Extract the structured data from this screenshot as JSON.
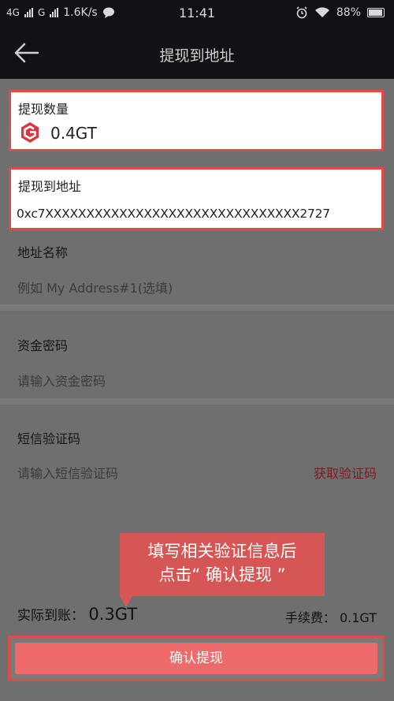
{
  "status_bar": {
    "network_1": "4G",
    "network_2": "G",
    "speed": "1.6K/s",
    "time": "11:41",
    "battery": "88%",
    "icons": [
      "signal-icon",
      "message-icon",
      "alarm-icon",
      "wifi-icon",
      "battery-icon"
    ]
  },
  "header": {
    "title": "提现到地址",
    "back_icon": "back-arrow-icon"
  },
  "amount": {
    "label": "提现数量",
    "coin_icon": "gt-coin-icon",
    "value": "0.4GT"
  },
  "address": {
    "label": "提现到地址",
    "value": "0xc7XXXXXXXXXXXXXXXXXXXXXXXXXXXXXXX2727"
  },
  "address_name": {
    "label": "地址名称",
    "placeholder": "例如 My Address#1(选填)"
  },
  "fund_password": {
    "label": "资金密码",
    "placeholder": "请输入资金密码"
  },
  "sms_code": {
    "label": "短信验证码",
    "placeholder": "请输入短信验证码",
    "action": "获取验证码"
  },
  "callout": {
    "line1": "填写相关验证信息后",
    "line2": "点击“ 确认提现 ”"
  },
  "summary": {
    "received_label": "实际到账：",
    "received_value": "0.3GT",
    "fee_label": "手续费：",
    "fee_value": "0.1GT"
  },
  "confirm_button": {
    "label": "确认提现"
  },
  "colors": {
    "accent": "#e24a4a",
    "button": "#ef6b6b",
    "callout": "#d65656",
    "overlay_bg": "#6f6f6f"
  }
}
